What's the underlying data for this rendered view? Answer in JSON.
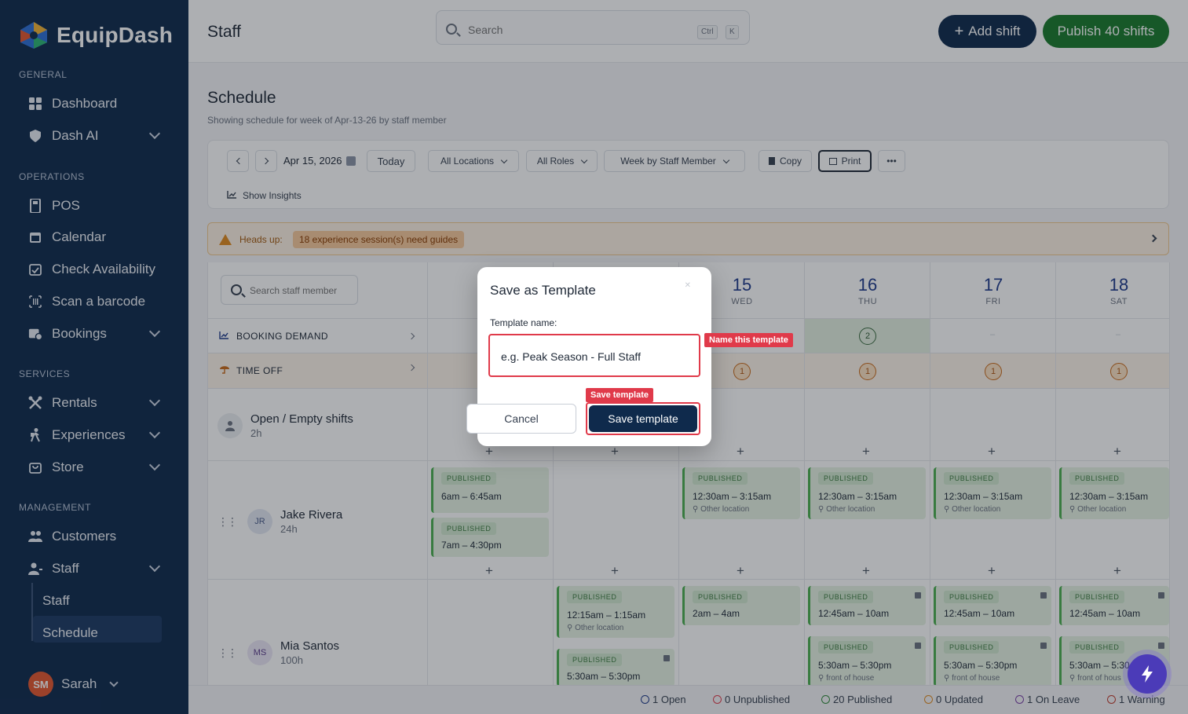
{
  "brand": {
    "name": "EquipDash"
  },
  "sidebar": {
    "sections": [
      "GENERAL",
      "OPERATIONS",
      "SERVICES",
      "MANAGEMENT"
    ],
    "general": [
      {
        "label": "Dashboard",
        "icon": "grid-icon"
      },
      {
        "label": "Dash AI",
        "icon": "shield-icon"
      }
    ],
    "operations": [
      {
        "label": "POS",
        "icon": "pos-icon"
      },
      {
        "label": "Calendar",
        "icon": "calendar-icon"
      },
      {
        "label": "Check Availability",
        "icon": "calendar-check-icon"
      },
      {
        "label": "Scan a barcode",
        "icon": "barcode-icon"
      },
      {
        "label": "Bookings",
        "icon": "bookings-icon"
      }
    ],
    "services": [
      {
        "label": "Rentals",
        "icon": "tools-icon"
      },
      {
        "label": "Experiences",
        "icon": "hiker-icon"
      },
      {
        "label": "Store",
        "icon": "store-icon"
      }
    ],
    "management": [
      {
        "label": "Customers",
        "icon": "customers-icon"
      },
      {
        "label": "Staff",
        "icon": "staff-icon"
      }
    ],
    "staff_sub": [
      "Staff",
      "Schedule"
    ],
    "user": {
      "initials": "SM",
      "name": "Sarah"
    }
  },
  "topbar": {
    "title": "Staff",
    "search_placeholder": "Search",
    "kbd1": "Ctrl",
    "kbd2": "K",
    "add_shift": "Add shift",
    "publish": "Publish 40 shifts"
  },
  "schedule": {
    "title": "Schedule",
    "subtitle": "Showing schedule for week of Apr-13-26 by staff member",
    "date": "Apr 15, 2026",
    "today": "Today",
    "locations": "All Locations",
    "roles": "All Roles",
    "view": "Week by Staff Member",
    "copy": "Copy",
    "print": "Print",
    "more": "•••",
    "insights": "Show Insights"
  },
  "headsup": {
    "label": "Heads up:",
    "pill": "18 experience session(s) need guides"
  },
  "grid": {
    "search_placeholder": "Search staff member",
    "booking_demand": "BOOKING DEMAND",
    "time_off": "TIME OFF",
    "days": [
      {
        "num": "15",
        "name": "WED"
      },
      {
        "num": "16",
        "name": "THU"
      },
      {
        "num": "17",
        "name": "FRI"
      },
      {
        "num": "18",
        "name": "SAT"
      }
    ],
    "demand_value": "2",
    "timeoff_value": "1",
    "dash": "–",
    "open_shifts": {
      "name": "Open / Empty shifts",
      "hours": "2h"
    },
    "jake": {
      "initials": "JR",
      "name": "Jake Rivera",
      "hours": "24h"
    },
    "mia": {
      "initials": "MS",
      "name": "Mia Santos",
      "hours": "100h"
    },
    "published": "PUBLISHED",
    "shifts": {
      "jake_mon_1": "6am – 6:45am",
      "jake_mon_2": "7am – 4:30pm",
      "jake_wed": "12:30am – 3:15am",
      "other_location": "Other location",
      "mia_tue_1": "12:15am – 1:15am",
      "mia_tue_2": "5:30am – 5:30pm",
      "mia_wed": "2am – 4am",
      "mia_thu_1": "12:45am – 10am",
      "mia_thu_2": "5:30am – 5:30pm",
      "mia_sat_2": "5:30am – 5:30",
      "front_of_house": "front of house",
      "front_of_house_short": "front of hous"
    }
  },
  "footer": [
    {
      "label": "1 Open",
      "color": "#1e3a8a"
    },
    {
      "label": "0 Unpublished",
      "color": "#e03a4a"
    },
    {
      "label": "20 Published",
      "color": "#2f8a3a"
    },
    {
      "label": "0 Updated",
      "color": "#e08a1f"
    },
    {
      "label": "1 On Leave",
      "color": "#7b3fa8"
    },
    {
      "label": "1 Warning",
      "color": "#c0392b"
    }
  ],
  "modal": {
    "title": "Save as Template",
    "field_label": "Template name:",
    "placeholder": "e.g. Peak Season - Full Staff",
    "cancel": "Cancel",
    "save": "Save template",
    "tag_name": "Name this template",
    "tag_save": "Save template"
  }
}
